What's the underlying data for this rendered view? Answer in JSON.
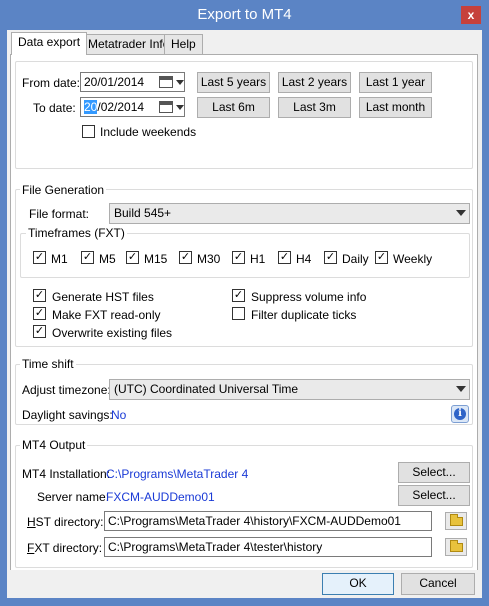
{
  "window": {
    "title": "Export to MT4",
    "close_label": "x"
  },
  "tabs": [
    {
      "label": "Data export",
      "active": true
    },
    {
      "label": "Metatrader Info",
      "active": false
    },
    {
      "label": "Help",
      "active": false
    }
  ],
  "dates": {
    "from_label": "From date:",
    "from_value": "20/01/2014",
    "to_label": "To date:",
    "to_value_selected": "20",
    "to_value_rest": "/02/2014",
    "include_weekends_label": "Include weekends",
    "include_weekends_checked": false
  },
  "quick_ranges": [
    "Last 5 years",
    "Last 2 years",
    "Last 1 year",
    "Last 6m",
    "Last 3m",
    "Last month"
  ],
  "file_generation": {
    "title": "File Generation",
    "file_format_label": "File format:",
    "file_format_value": "Build 545+",
    "timeframes_title": "Timeframes (FXT)",
    "timeframes": [
      {
        "label": "M1",
        "checked": true
      },
      {
        "label": "M5",
        "checked": true
      },
      {
        "label": "M15",
        "checked": true
      },
      {
        "label": "M30",
        "checked": true
      },
      {
        "label": "H1",
        "checked": true
      },
      {
        "label": "H4",
        "checked": true
      },
      {
        "label": "Daily",
        "checked": true
      },
      {
        "label": "Weekly",
        "checked": true
      }
    ],
    "options": {
      "generate_hst": {
        "label": "Generate HST files",
        "checked": true
      },
      "make_fxt_readonly": {
        "label": "Make FXT read-only",
        "checked": true
      },
      "overwrite_existing": {
        "label": "Overwrite existing files",
        "checked": true
      },
      "suppress_volume": {
        "label": "Suppress volume info",
        "checked": true
      },
      "filter_duplicate": {
        "label": "Filter duplicate ticks",
        "checked": false
      }
    }
  },
  "time_shift": {
    "title": "Time shift",
    "adjust_label": "Adjust timezone:",
    "adjust_value": "(UTC) Coordinated Universal Time",
    "daylight_label": "Daylight savings:",
    "daylight_value": "No",
    "info_icon": "info-icon"
  },
  "mt4_output": {
    "title": "MT4 Output",
    "installation_label": "MT4 Installation:",
    "installation_value": "C:\\Programs\\MetaTrader 4",
    "server_label": "Server name:",
    "server_value": "FXCM-AUDDemo01",
    "select_label": "Select...",
    "hst_label_first": "H",
    "hst_label_rest": "ST directory:",
    "hst_value": "C:\\Programs\\MetaTrader 4\\history\\FXCM-AUDDemo01",
    "fxt_label_first": "F",
    "fxt_label_rest": "XT directory:",
    "fxt_value": "C:\\Programs\\MetaTrader 4\\tester\\history"
  },
  "footer": {
    "ok_label": "OK",
    "cancel_label": "Cancel"
  },
  "colors": {
    "titlebar": "#5b84c5",
    "link_blue": "#1a3ad6",
    "close": "#c6413b"
  }
}
